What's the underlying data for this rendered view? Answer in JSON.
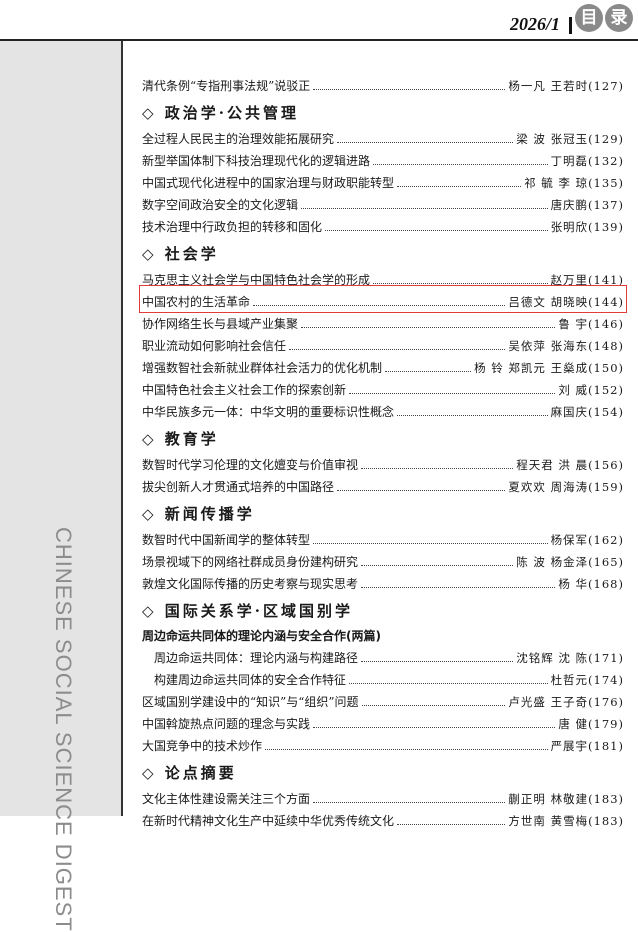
{
  "header": {
    "issue": "2026/1",
    "badge_chars": [
      "目",
      "录"
    ]
  },
  "sidebar": {
    "vertical_text": "CHINESE SOCIAL SCIENCE DIGEST"
  },
  "toc": {
    "top": [
      {
        "title": "清代条例“专指刑事法规”说驳正",
        "author": "杨一凡  王若时(127)"
      }
    ],
    "politics": {
      "heading": "◇ 政治学·公共管理",
      "items": [
        {
          "title": "全过程人民民主的治理效能拓展研究",
          "author": "梁  波  张冠玉(129)"
        },
        {
          "title": "新型举国体制下科技治理现代化的逻辑进路",
          "author": "丁明磊(132)"
        },
        {
          "title": "中国式现代化进程中的国家治理与财政职能转型",
          "author": "祁  毓  李  琼(135)"
        },
        {
          "title": "数字空间政治安全的文化逻辑",
          "author": "唐庆鹏(137)"
        },
        {
          "title": "技术治理中行政负担的转移和固化",
          "author": "张明欣(139)"
        }
      ]
    },
    "sociology": {
      "heading": "◇ 社会学",
      "items": [
        {
          "title": "马克思主义社会学与中国特色社会学的形成",
          "author": "赵万里(141)"
        },
        {
          "title": "中国农村的生活革命",
          "author": "吕德文  胡晓映(144)"
        },
        {
          "title": "协作网络生长与县域产业集聚",
          "author": "鲁  宇(146)"
        },
        {
          "title": "职业流动如何影响社会信任",
          "author": "吴依萍  张海东(148)"
        },
        {
          "title": "增强数智社会新就业群体社会活力的优化机制",
          "author": "杨  铃  郑凯元  王燊成(150)"
        },
        {
          "title": "中国特色社会主义社会工作的探索创新",
          "author": "刘  威(152)"
        },
        {
          "title": "中华民族多元一体：中华文明的重要标识性概念",
          "author": "麻国庆(154)"
        }
      ]
    },
    "education": {
      "heading": "◇ 教育学",
      "items": [
        {
          "title": "数智时代学习伦理的文化嬗变与价值审视",
          "author": "程天君  洪  晨(156)"
        },
        {
          "title": "拔尖创新人才贯通式培养的中国路径",
          "author": "夏欢欢  周海涛(159)"
        }
      ]
    },
    "journalism": {
      "heading": "◇ 新闻传播学",
      "items": [
        {
          "title": "数智时代中国新闻学的整体转型",
          "author": "杨保军(162)"
        },
        {
          "title": "场景视域下的网络社群成员身份建构研究",
          "author": "陈  波  杨金泽(165)"
        },
        {
          "title": "敦煌文化国际传播的历史考察与现实思考",
          "author": "杨  华(168)"
        }
      ]
    },
    "international": {
      "heading": "◇ 国际关系学·区域国别学",
      "group_title": "周边命运共同体的理论内涵与安全合作(两篇)",
      "sub_items": [
        {
          "title": "周边命运共同体：理论内涵与构建路径",
          "author": "沈铭辉  沈  陈(171)"
        },
        {
          "title": "构建周边命运共同体的安全合作特征",
          "author": "杜哲元(174)"
        }
      ],
      "items": [
        {
          "title": "区域国别学建设中的“知识”与“组织”问题",
          "author": "卢光盛  王子奇(176)"
        },
        {
          "title": "中国斡旋热点问题的理念与实践",
          "author": "唐  健(179)"
        },
        {
          "title": "大国竞争中的技术炒作",
          "author": "严展宇(181)"
        }
      ]
    },
    "abstracts": {
      "heading": "◇ 论点摘要",
      "items": [
        {
          "title": "文化主体性建设需关注三个方面",
          "author": "蒯正明  林敬建(183)"
        },
        {
          "title": "在新时代精神文化生产中延续中华优秀传统文化",
          "author": "方世南  黄雪梅(183)"
        }
      ]
    }
  }
}
